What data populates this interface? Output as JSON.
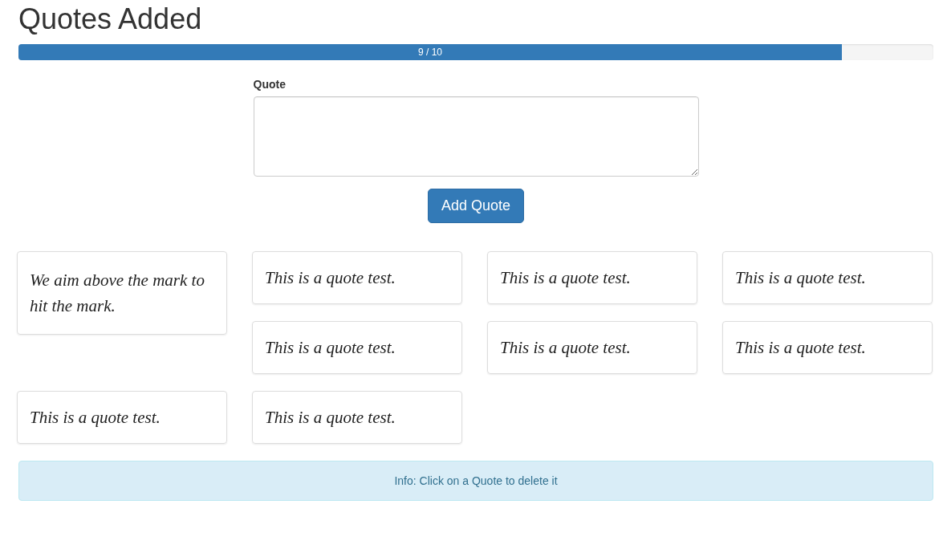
{
  "title": "Quotes Added",
  "progress": {
    "label": "9 / 10",
    "level": 0.9
  },
  "form": {
    "label": "Quote",
    "button": "Add Quote"
  },
  "quotes": [
    {
      "text": "We aim above the mark to hit the mark."
    },
    {
      "text": "This is a quote test."
    },
    {
      "text": "This is a quote test."
    },
    {
      "text": "This is a quote test."
    },
    {
      "text": "This is a quote test."
    },
    {
      "text": "This is a quote test."
    },
    {
      "text": "This is a quote test."
    },
    {
      "text": "This is a quote test."
    },
    {
      "text": "This is a quote test."
    }
  ],
  "info": "Info: Click on a Quote to delete it"
}
